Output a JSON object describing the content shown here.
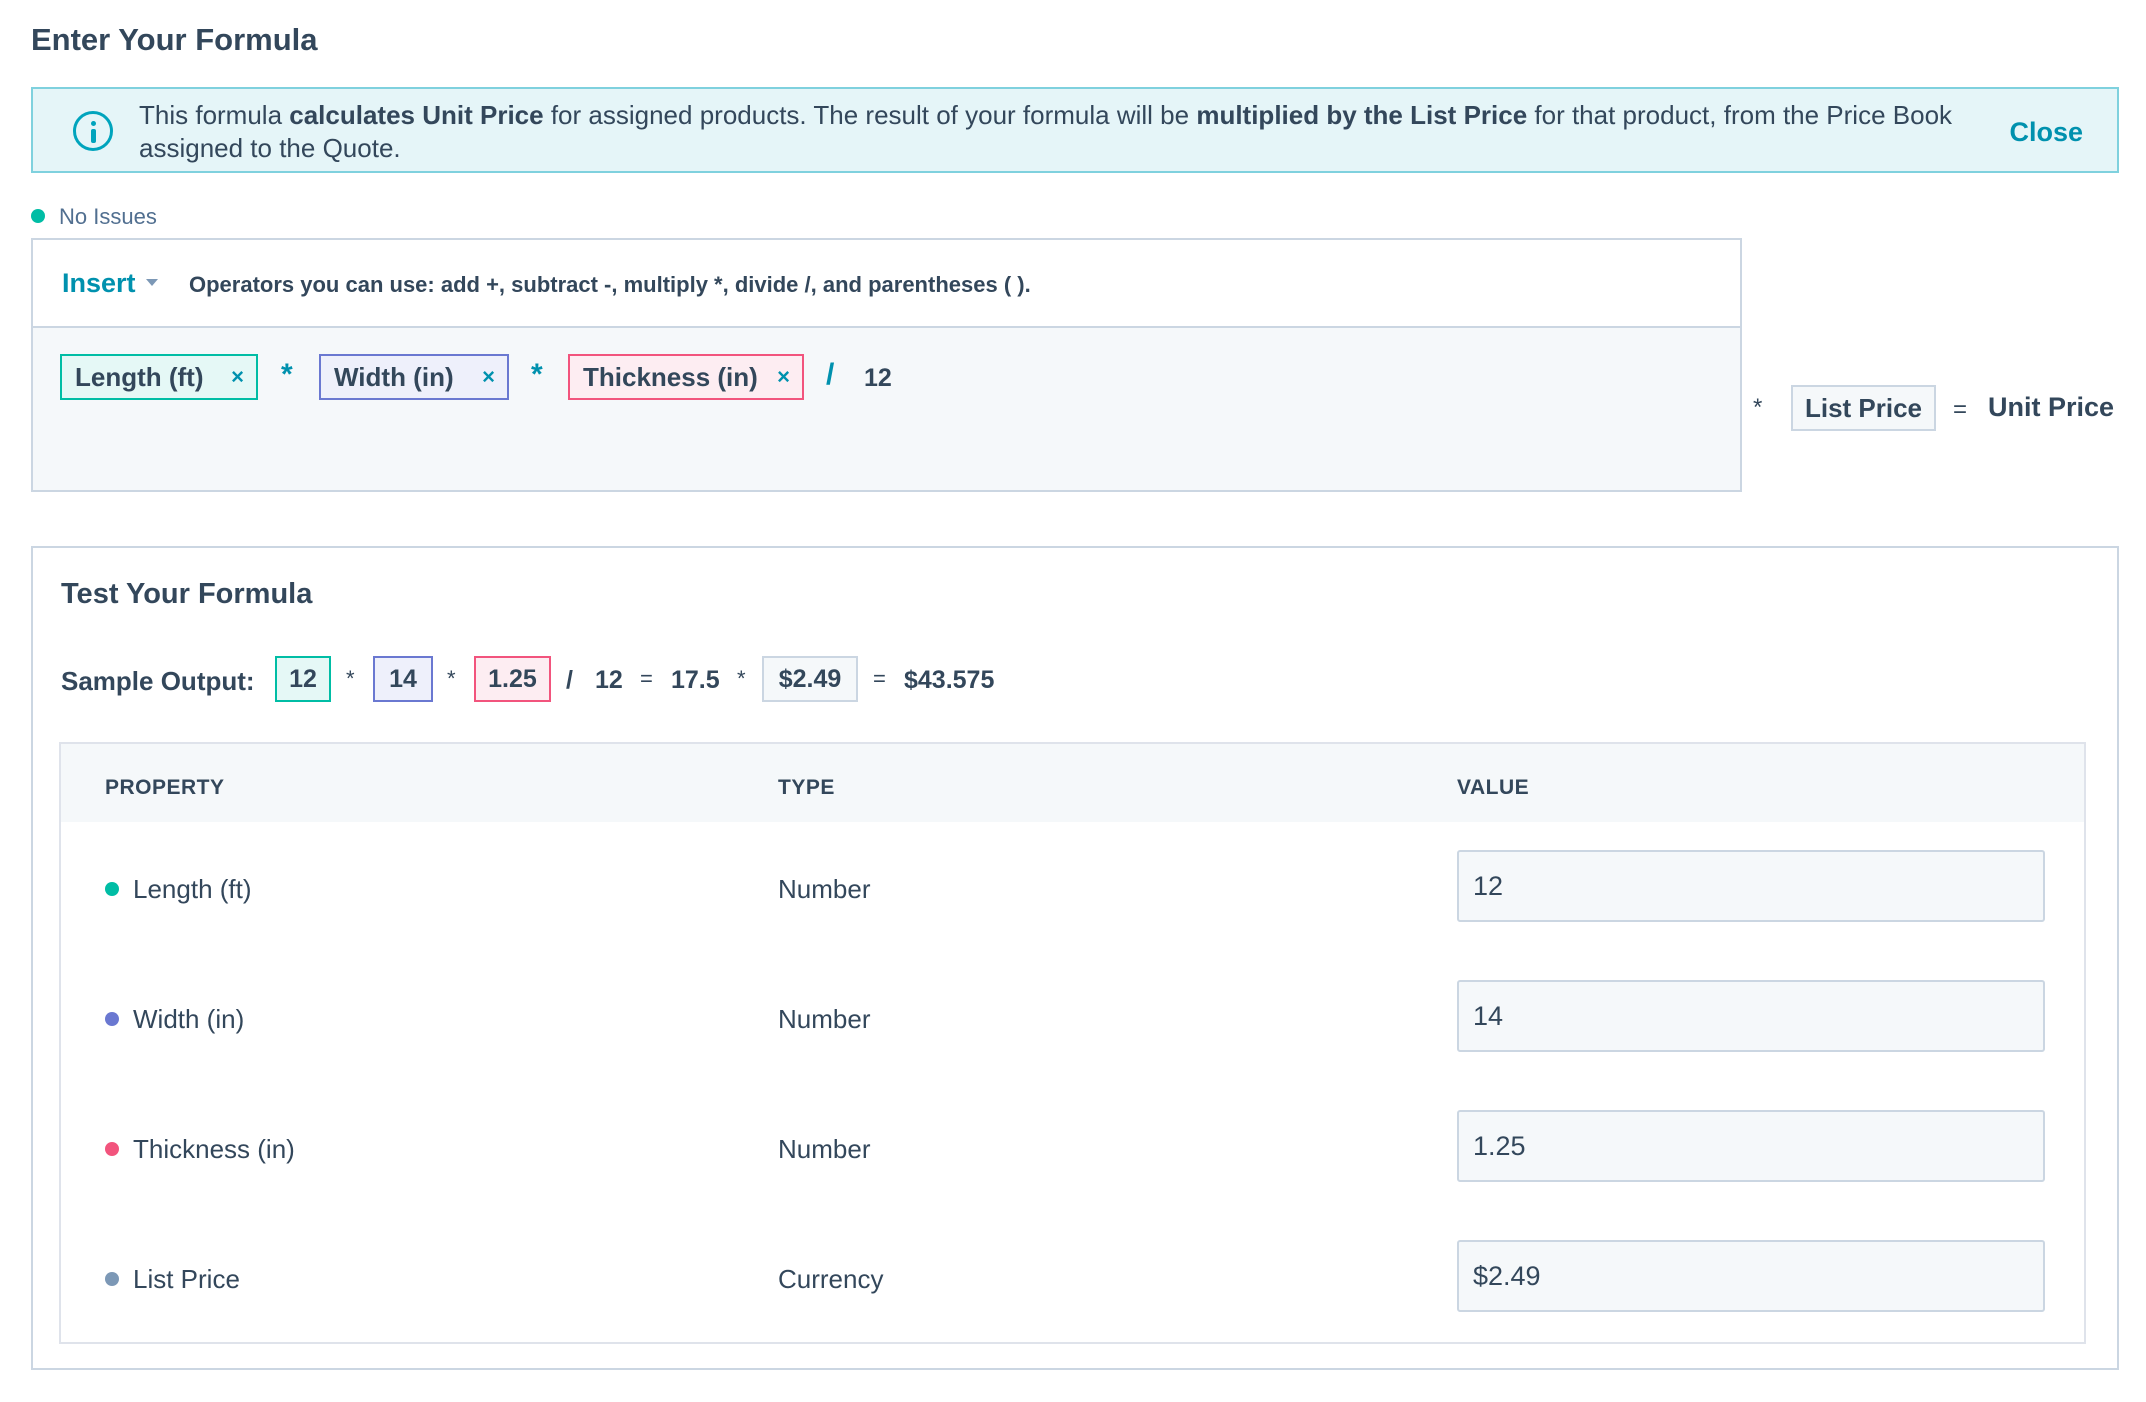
{
  "page": {
    "title": "Enter Your Formula"
  },
  "banner": {
    "t1": "This formula ",
    "b1": "calculates Unit Price",
    "t2": " for assigned products. The result of your formula will be ",
    "b2": "multiplied by the List Price",
    "t3": " for that product, from the Price Book assigned to the Quote.",
    "close": "Close"
  },
  "status": {
    "text": "No Issues",
    "color": "#00bda5"
  },
  "editor": {
    "insert_label": "Insert",
    "operators_hint": "Operators you can use: add +, subtract -, multiply *, divide /, and parentheses ( ).",
    "tokens": {
      "length": "Length (ft)",
      "width": "Width (in)",
      "thickness": "Thickness (in)",
      "op1": "*",
      "op2": "*",
      "op3": "/",
      "num": "12",
      "remove": "×"
    },
    "suffix": {
      "op_mult": "*",
      "list_price": "List Price",
      "op_eq": "=",
      "result": "Unit Price"
    }
  },
  "test": {
    "title": "Test Your Formula",
    "sample_label": "Sample Output:",
    "sample": {
      "length": "12",
      "op1": "*",
      "width": "14",
      "op2": "*",
      "thickness": "1.25",
      "op3": "/",
      "divisor": "12",
      "eq1": "=",
      "subtotal": "17.5",
      "op4": "*",
      "price": "$2.49",
      "eq2": "=",
      "total": "$43.575"
    },
    "table": {
      "headers": {
        "property": "PROPERTY",
        "type": "TYPE",
        "value": "VALUE"
      },
      "rows": [
        {
          "property": "Length (ft)",
          "type": "Number",
          "value": "12",
          "color": "#00bda5"
        },
        {
          "property": "Width (in)",
          "type": "Number",
          "value": "14",
          "color": "#6a78d1"
        },
        {
          "property": "Thickness (in)",
          "type": "Number",
          "value": "1.25",
          "color": "#f2547d"
        },
        {
          "property": "List Price",
          "type": "Currency",
          "value": "$2.49",
          "color": "#7c98b6"
        }
      ]
    }
  },
  "colors": {
    "accent": "#0091ae",
    "teal": "#00bda5",
    "blue": "#6a78d1",
    "pink": "#f2547d"
  },
  "icons": {
    "info": "info-circle-icon",
    "caret": "caret-down-icon",
    "remove": "close-icon"
  }
}
